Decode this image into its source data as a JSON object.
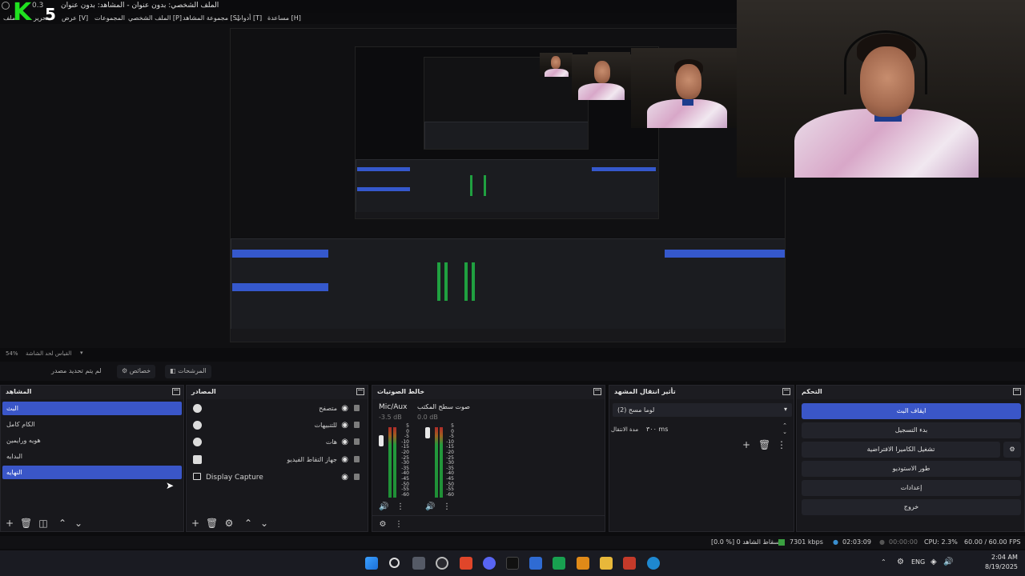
{
  "window": {
    "title": "الملف الشخصي: بدون عنوان - المشاهد: بدون عنوان",
    "title_fragment_left": "0.3"
  },
  "menu": {
    "items": [
      "مساعدة [H]",
      "أدوات [T]",
      "مجموعة المشاهد [S]",
      "الملف الشخصي [P]",
      "المجموعات",
      "عرض [V]",
      "تحرير",
      "ملف"
    ]
  },
  "preview": {
    "zoom": "54%",
    "zoom_label": "القياس لحد الشاشة"
  },
  "tabs": {
    "no_source": "لم يتم تحديد مصدر",
    "properties": "خصائص",
    "filters": "المرشحات"
  },
  "scenes": {
    "title": "المشاهد",
    "items": [
      "البث",
      "الكام كامل",
      "هويه ورايمين",
      "البدايه",
      "النهايه"
    ],
    "selected_indices": [
      0,
      4
    ]
  },
  "sources": {
    "title": "المصادر",
    "items": [
      {
        "name": "متصفح",
        "icon": "globe-icon"
      },
      {
        "name": "للتنبيهات",
        "icon": "globe-icon"
      },
      {
        "name": "هات",
        "icon": "globe-icon"
      },
      {
        "name": "جهاز التقاط الفيديو",
        "icon": "camera-icon"
      },
      {
        "name": "Display Capture",
        "icon": "monitor-icon"
      }
    ]
  },
  "mixer": {
    "title": "خالط الصوتيات",
    "channels": [
      {
        "name": "Mic/Aux",
        "db": "-3.5 dB"
      },
      {
        "name": "صوت سطح المكتب",
        "db": "0.0 dB"
      }
    ],
    "scale": [
      "5",
      "0",
      "-5",
      "-10",
      "-15",
      "-20",
      "-25",
      "-30",
      "-35",
      "-40",
      "-45",
      "-50",
      "-55",
      "-60"
    ]
  },
  "transitions": {
    "title": "تأثير انتقال المشهد",
    "selected": "(2) لوما مسح",
    "duration_label": "مدة الانتقال",
    "duration_value": "٣٠٠ ms"
  },
  "controls": {
    "title": "التحكم",
    "stop_stream": "ايقاف البث",
    "start_record": "بدء التسجيل",
    "virtual_camera": "تشغيل الكاميرا الافتراضية",
    "studio_mode": "طور الاستوديو",
    "settings": "إعدادات",
    "exit": "خروج"
  },
  "status": {
    "dropped": "[0.0 %] إسقاط الشاهد 0",
    "bitrate": "7301 kbps",
    "stream_time": "02:03:09",
    "rec_time": "00:00:00",
    "cpu": "CPU: 2.3%",
    "fps": "60.00 / 60.00 FPS"
  },
  "taskbar": {
    "lang": "ENG",
    "time": "2:04 AM",
    "date": "8/19/2025"
  },
  "overlay": {
    "logo_text": "K",
    "logo_number": "5"
  },
  "colors": {
    "accent": "#3a56c8",
    "logo": "#20e020",
    "meter_green": "#239a3c"
  }
}
